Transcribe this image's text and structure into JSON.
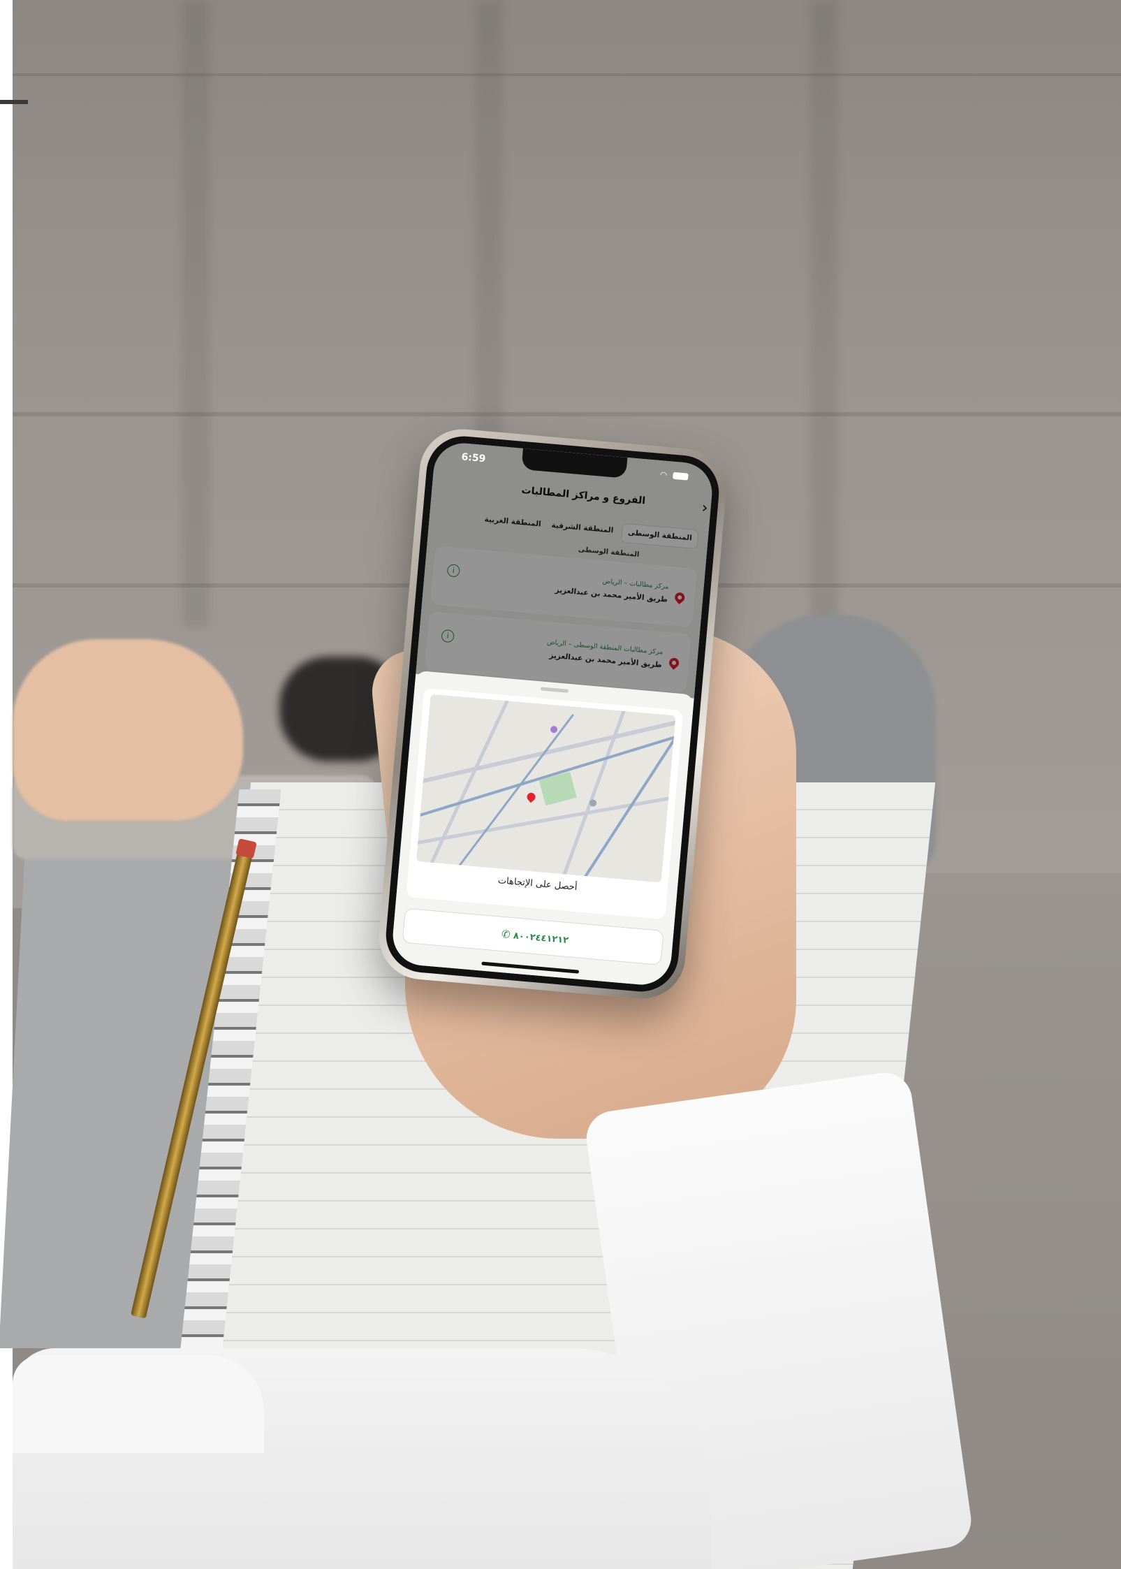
{
  "status_bar": {
    "time": "6:59"
  },
  "nav": {
    "title": "الفروع و مراكز المطالبات",
    "back_icon": "chevron-right-icon"
  },
  "tabs": [
    {
      "label": "المنطقة الوسطى",
      "active": true
    },
    {
      "label": "المنطقة الشرقية",
      "active": false
    },
    {
      "label": "المنطقة الغربية",
      "active": false
    }
  ],
  "section_title": "المنطقة الوسطى",
  "branches": [
    {
      "name": "مركز مطالبات – الرياض",
      "address": "طريق الأمير محمد بن عبدالعزيز"
    },
    {
      "name": "مركز مطالبات المنطقة الوسطى – الرياض",
      "address": "طريق الأمير محمد بن عبدالعزيز"
    }
  ],
  "map_card": {
    "action_label": "أحصل على الإتجاهات"
  },
  "call_button": {
    "label": "٨٠٠٢٤٤١٢١٢"
  },
  "colors": {
    "accent": "#2a8a47",
    "pin": "#e3212b"
  }
}
